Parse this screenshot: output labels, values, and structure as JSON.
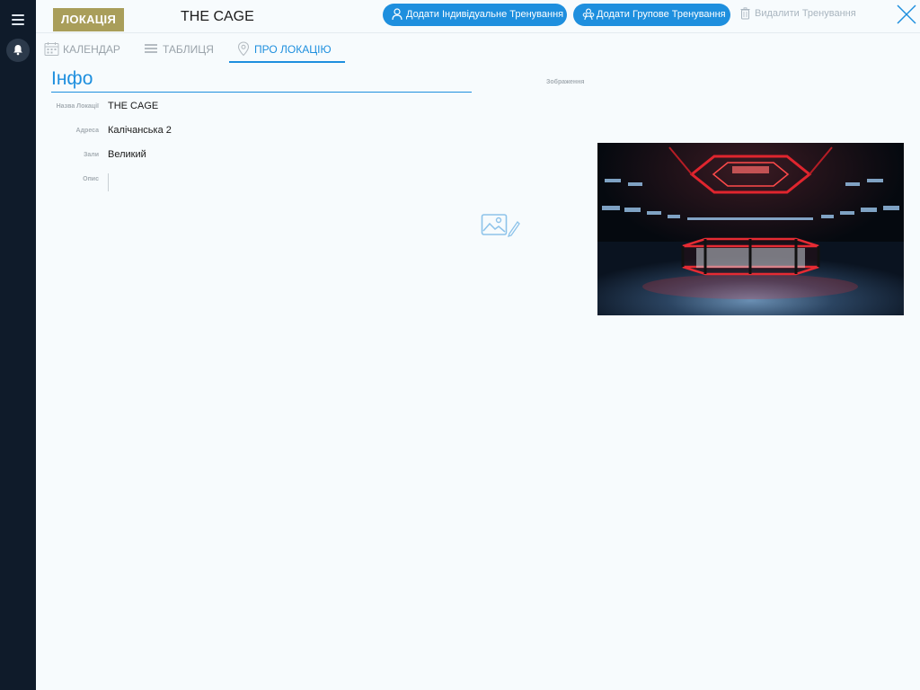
{
  "sidebar": {
    "menu_icon": "hamburger-icon",
    "bell_icon": "bell-icon"
  },
  "header": {
    "badge": "ЛОКАЦІЯ",
    "title": "THE CAGE",
    "btn_individual": "Додати Індивідуальне Тренування",
    "btn_group": "Додати Групове Тренування",
    "btn_delete": "Видалити Тренування"
  },
  "tabs": [
    {
      "label": "КАЛЕНДАР",
      "icon": "calendar-icon"
    },
    {
      "label": "ТАБЛИЦЯ",
      "icon": "table-icon"
    },
    {
      "label": "ПРО ЛОКАЦІЮ",
      "icon": "location-pin-icon"
    }
  ],
  "info": {
    "heading": "Інфо",
    "fields": [
      {
        "label": "Назва Локації",
        "value": "THE CAGE"
      },
      {
        "label": "Адреса",
        "value": "Калічанська 2"
      },
      {
        "label": "Зали",
        "value": "Великий"
      },
      {
        "label": "Опис",
        "value": ""
      }
    ],
    "image_label": "Зображення"
  },
  "colors": {
    "accent": "#1e8fde",
    "badge": "#a99e5a",
    "rail": "#0f1b2a"
  }
}
